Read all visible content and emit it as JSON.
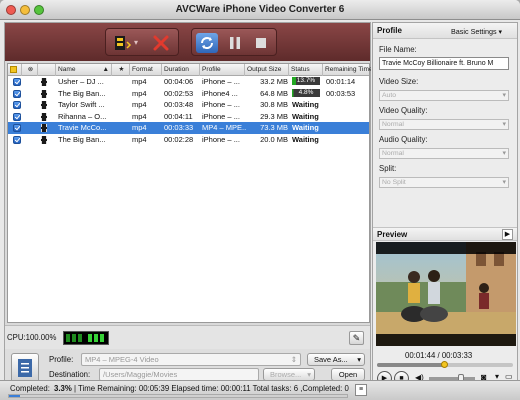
{
  "window": {
    "title": "AVCWare iPhone Video Converter 6"
  },
  "table": {
    "headers": {
      "name": "Name",
      "format": "Format",
      "duration": "Duration",
      "profile": "Profile",
      "output_size": "Output Size",
      "status": "Status",
      "remaining_time": "Remaining Time"
    },
    "rows": [
      {
        "name": "Usher – DJ ...",
        "format": "mp4",
        "duration": "00:04:06",
        "profile": "iPhone – ...",
        "size": "33.2 MB",
        "status": "13.7%",
        "status_type": "progress",
        "progress": 0.137,
        "remaining": "00:01:14",
        "selected": false
      },
      {
        "name": "The Big Ban...",
        "format": "mp4",
        "duration": "00:02:53",
        "profile": "iPhone4 ...",
        "size": "64.8 MB",
        "status": "4.8%",
        "status_type": "progress",
        "progress": 0.048,
        "remaining": "00:03:53",
        "selected": false
      },
      {
        "name": "Taylor Swift ...",
        "format": "mp4",
        "duration": "00:03:48",
        "profile": "iPhone – ...",
        "size": "30.8 MB",
        "status": "Waiting",
        "status_type": "text",
        "remaining": "",
        "selected": false
      },
      {
        "name": "Rihanna – O...",
        "format": "mp4",
        "duration": "00:04:11",
        "profile": "iPhone – ...",
        "size": "29.3 MB",
        "status": "Waiting",
        "status_type": "text",
        "remaining": "",
        "selected": false
      },
      {
        "name": "Travie McCo...",
        "format": "mp4",
        "duration": "00:03:33",
        "profile": "MP4 – MPE...",
        "size": "73.3 MB",
        "status": "Waiting",
        "status_type": "text",
        "remaining": "",
        "selected": true
      },
      {
        "name": "The Big Ban...",
        "format": "mp4",
        "duration": "00:02:28",
        "profile": "iPhone – ...",
        "size": "20.0 MB",
        "status": "Waiting",
        "status_type": "text",
        "remaining": "",
        "selected": false
      }
    ]
  },
  "cpu": {
    "label": "CPU:100.00%"
  },
  "bottom": {
    "profile_label": "Profile:",
    "profile_value": "MP4 – MPEG-4 Video",
    "save_as": "Save As...",
    "destination_label": "Destination:",
    "destination_value": "/Users/Maggie/Movies",
    "browse": "Browse...",
    "open": "Open"
  },
  "right": {
    "header": "Profile",
    "basic_settings": "Basic Settings",
    "file_name_label": "File Name:",
    "file_name_value": "Travie McCoy Billionaire ft. Bruno M",
    "video_size_label": "Video Size:",
    "video_size_value": "Auto",
    "video_quality_label": "Video Quality:",
    "video_quality_value": "Normal",
    "audio_quality_label": "Audio Quality:",
    "audio_quality_value": "Normal",
    "split_label": "Split:",
    "split_value": "No Split",
    "preview_label": "Preview",
    "time": "00:01:44 / 00:03:33",
    "seek_progress": 0.49,
    "volume_level": 0.7
  },
  "status": {
    "completed_label": "Completed:",
    "completed_value": "3.3%",
    "rest": "| Time Remaining: 00:05:39 Elapsed time: 00:00:11 Total tasks: 6 ,Completed: 0"
  },
  "colors": {
    "selection": "#3a7fd8",
    "toolbar": "#7a3b3b",
    "progress_green": "#22a822"
  }
}
